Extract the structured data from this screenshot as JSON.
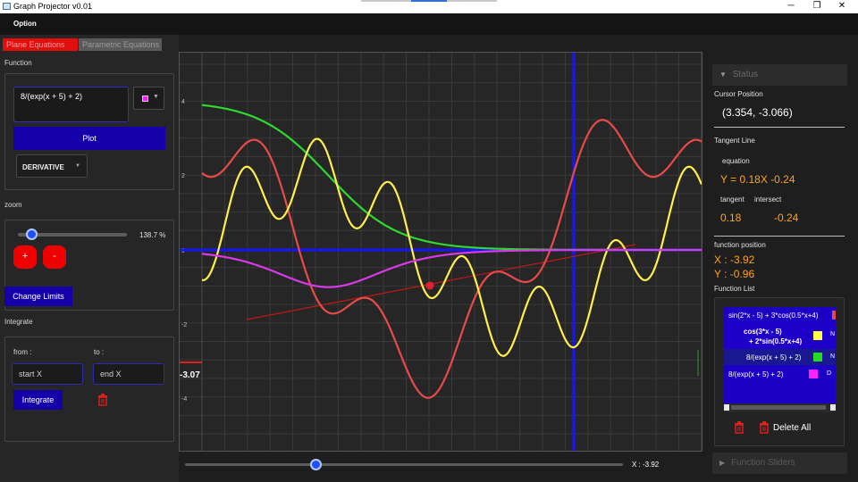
{
  "window": {
    "title": "Graph Projector v0.01",
    "min": "─",
    "max": "❐",
    "close": "✕"
  },
  "menu": {
    "option": "Option"
  },
  "tabs": {
    "plane": "Plane Equations",
    "parametric": "Parametric Equations"
  },
  "function_section": {
    "label": "Function",
    "input_value": "8/(exp(x + 5) + 2)",
    "selected_color": "#ff1aff",
    "plot_button": "Plot",
    "mode_select": "DERIVATIVE"
  },
  "zoom": {
    "label": "zoom",
    "value_text": "138.7 %",
    "plus": "+",
    "minus": "-",
    "slider_fraction": 0.13
  },
  "change_limits": "Change Limits",
  "integrate": {
    "label": "Integrate",
    "from_label": "from :",
    "to_label": "to :",
    "start_placeholder": "start X",
    "end_placeholder": "end X",
    "button": "Integrate"
  },
  "graph": {
    "y_ticks": [
      "4",
      "2",
      "0",
      "-2",
      "-4"
    ],
    "cursor_y_label": "-3.07",
    "x_readout": "X : -3.92",
    "x_slider_fraction": 0.3,
    "colors": {
      "red": "#e84a4a",
      "yellow": "#ffef4d",
      "green": "#2ed82e",
      "magenta": "#d83ae8",
      "axis": "#1010ff",
      "tangent": "#c01818"
    }
  },
  "status": {
    "header": "Status",
    "cursor_position_label": "Cursor Position",
    "cursor_position": "(3.354, -3.066)",
    "tangent_line_label": "Tangent Line",
    "equation_label": "equation",
    "equation": "Y = 0.18X -0.24",
    "tangent_label": "tangent",
    "intersect_label": "intersect",
    "tangent_value": "0.18",
    "intersect_value": "-0.24",
    "function_position_label": "function position",
    "fx": "X : -3.92",
    "fy": "Y : -0.96",
    "function_list_label": "Function List",
    "functions": [
      {
        "expr": "sin(2*x - 5) + 3*cos(0.5*x+4)",
        "color": "#e84a4a",
        "suffix": ""
      },
      {
        "expr_line1": "cos(3*x - 5)",
        "expr_line2": "+ 2*sin(0.5*x+4)",
        "color": "#ffff44",
        "suffix": "N"
      },
      {
        "expr": "8/(exp(x + 5) + 2)",
        "color": "#22dd22",
        "suffix": "N"
      },
      {
        "expr": "8/(exp(x + 5) + 2)",
        "color": "#ff22ff",
        "suffix": "D"
      }
    ],
    "delete_all": "Delete All",
    "function_sliders": "Function Sliders"
  }
}
